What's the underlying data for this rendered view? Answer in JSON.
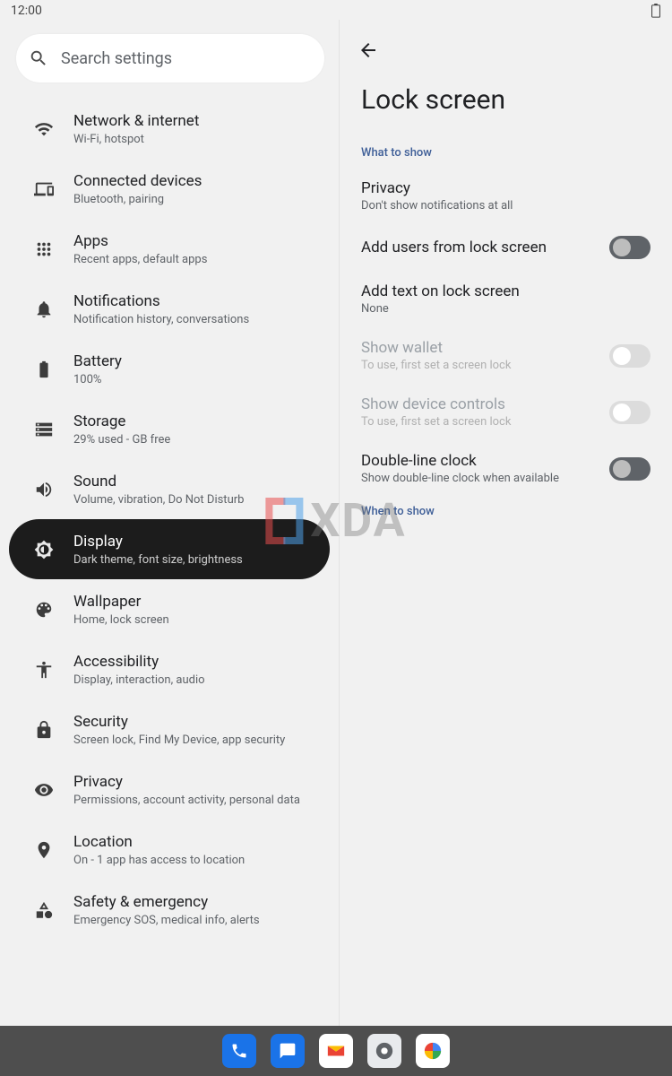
{
  "status": {
    "time": "12:00"
  },
  "search": {
    "placeholder": "Search settings"
  },
  "sidebar": [
    {
      "key": "network",
      "title": "Network & internet",
      "sub": "Wi-Fi, hotspot"
    },
    {
      "key": "connected",
      "title": "Connected devices",
      "sub": "Bluetooth, pairing"
    },
    {
      "key": "apps",
      "title": "Apps",
      "sub": "Recent apps, default apps"
    },
    {
      "key": "notif",
      "title": "Notifications",
      "sub": "Notification history, conversations"
    },
    {
      "key": "battery",
      "title": "Battery",
      "sub": "100%"
    },
    {
      "key": "storage",
      "title": "Storage",
      "sub": "29% used -         GB free"
    },
    {
      "key": "sound",
      "title": "Sound",
      "sub": "Volume, vibration, Do Not Disturb"
    },
    {
      "key": "display",
      "title": "Display",
      "sub": "Dark theme, font size, brightness",
      "selected": true
    },
    {
      "key": "wallpaper",
      "title": "Wallpaper",
      "sub": "Home, lock screen"
    },
    {
      "key": "a11y",
      "title": "Accessibility",
      "sub": "Display, interaction, audio"
    },
    {
      "key": "security",
      "title": "Security",
      "sub": "Screen lock, Find My Device, app security"
    },
    {
      "key": "privacy",
      "title": "Privacy",
      "sub": "Permissions, account activity, personal data"
    },
    {
      "key": "location",
      "title": "Location",
      "sub": "On - 1 app has access to location"
    },
    {
      "key": "safety",
      "title": "Safety & emergency",
      "sub": "Emergency SOS, medical info, alerts"
    }
  ],
  "detail": {
    "title": "Lock screen",
    "sections": {
      "what_to_show": "What to show",
      "when_to_show": "When to show"
    },
    "rows": {
      "privacy": {
        "title": "Privacy",
        "sub": "Don't show notifications at all"
      },
      "add_users": {
        "title": "Add users from lock screen"
      },
      "add_text": {
        "title": "Add text on lock screen",
        "sub": "None"
      },
      "show_wallet": {
        "title": "Show wallet",
        "sub": "To use, first set a screen lock"
      },
      "show_controls": {
        "title": "Show device controls",
        "sub": "To use, first set a screen lock"
      },
      "double_clock": {
        "title": "Double-line clock",
        "sub": "Show double-line clock when available"
      }
    }
  },
  "watermark": "XDA"
}
